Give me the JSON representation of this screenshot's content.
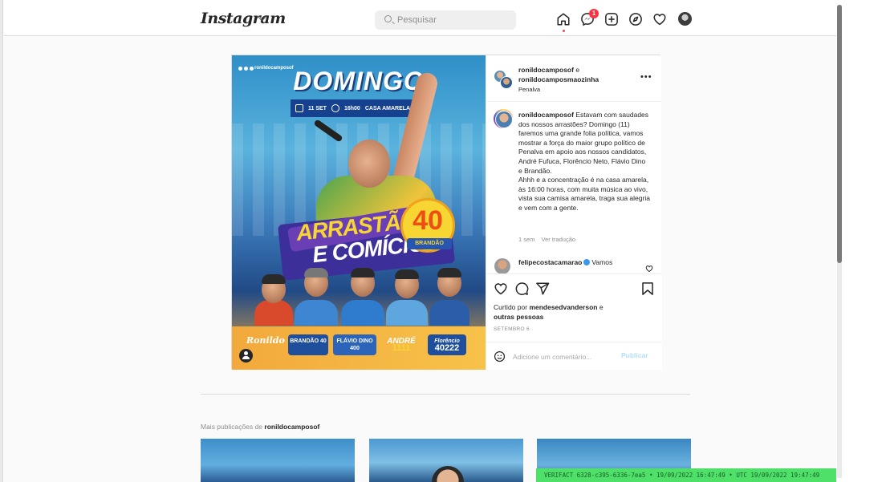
{
  "header": {
    "logo_text": "Instagram",
    "search_placeholder": "Pesquisar",
    "notification_count": "1",
    "icons": [
      "home-icon",
      "messenger-icon",
      "new-post-icon",
      "explore-icon",
      "activity-heart-icon",
      "profile-avatar"
    ]
  },
  "post": {
    "image": {
      "handle_small": "ronildocamposof",
      "headline": "DOMINGO",
      "date_text": "11 SET",
      "time_text": "16h00",
      "place_text": "CASA AMARELA",
      "line1": "ARRASTÃO",
      "line2": "E COMÍCIO",
      "number": "40",
      "number_name": "BRANDÃO",
      "signature": "Ronildo Campos",
      "logo1": "BRANDÃO 40",
      "logo2": "FLÁVIO DINO 400",
      "logo3_name": "ANDRÉ",
      "logo3_num": "1111",
      "logo4_name": "Florêncio",
      "logo4_num": "40222"
    },
    "author": "ronildocamposof",
    "coauthor_conj": "e",
    "coauthor": "ronildocamposmaozinha",
    "location": "Penalva",
    "caption_user": "ronildocamposof",
    "caption_text_1": "Estavam com saudades dos nossos arrastões? Domingo (11) faremos uma grande folia política, vamos mostrar a força do maior grupo político de Penalva em apoio aos nossos candidatos, André Fufuca, Florêncio Neto, Flávio Dino e Brandão.",
    "caption_text_2": "Ahhh e a concentração é na casa amarela, às 16:00 horas, com muita música ao vivo, vista sua camisa amarela, traga sua alegria e vem com a gente.",
    "caption_age": "1 sem",
    "translate_label": "Ver tradução",
    "comment_user": "felipecostacamarao",
    "comment_text": "Vamos",
    "liked_prefix": "Curtido por",
    "liked_user": "mendesedvanderson",
    "liked_suffix_1": "e",
    "liked_suffix_2": "outras pessoas",
    "date": "SETEMBRO 6",
    "comment_placeholder": "Adicione um comentário...",
    "publish_label": "Publicar"
  },
  "more": {
    "prefix": "Mais publicações de",
    "user": "ronildocamposof"
  },
  "watermark": "VERIFACT 6328-c395-6336-7ea5 • 19/09/2022 16:47:49 • UTC 19/09/2022 19:47:49",
  "colors": {
    "accent": "#3897f0",
    "badge": "#ff3040",
    "watermark_bg": "#4fe06a"
  }
}
